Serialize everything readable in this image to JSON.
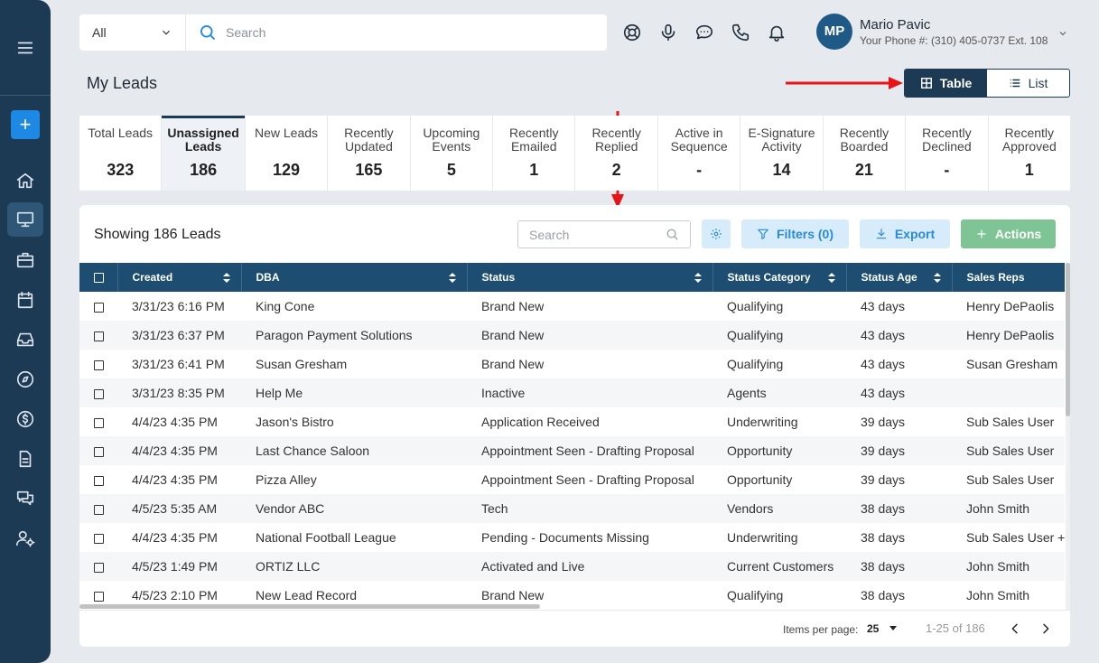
{
  "search": {
    "category": "All",
    "placeholder": "Search"
  },
  "header_icons": [
    "lifebuoy-icon",
    "microphone-icon",
    "chat-icon",
    "phone-icon",
    "bell-icon"
  ],
  "user": {
    "initials": "MP",
    "name": "Mario Pavic",
    "phone": "Your Phone #: (310) 405-0737 Ext. 108"
  },
  "page_title": "My Leads",
  "view_toggle": {
    "table_label": "Table",
    "list_label": "List",
    "selected": "Table"
  },
  "stats": [
    {
      "label": "Total Leads",
      "value": "323",
      "active": false
    },
    {
      "label": "Unassigned Leads",
      "value": "186",
      "active": true
    },
    {
      "label": "New Leads",
      "value": "129",
      "active": false
    },
    {
      "label": "Recently Updated",
      "value": "165",
      "active": false
    },
    {
      "label": "Upcoming Events",
      "value": "5",
      "active": false
    },
    {
      "label": "Recently Emailed",
      "value": "1",
      "active": false
    },
    {
      "label": "Recently Replied",
      "value": "2",
      "active": false
    },
    {
      "label": "Active in Sequence",
      "value": "-",
      "active": false
    },
    {
      "label": "E-Signature Activity",
      "value": "14",
      "active": false
    },
    {
      "label": "Recently Boarded",
      "value": "21",
      "active": false
    },
    {
      "label": "Recently Declined",
      "value": "-",
      "active": false
    },
    {
      "label": "Recently Approved",
      "value": "1",
      "active": false
    }
  ],
  "panel": {
    "showing": "Showing 186 Leads",
    "search_placeholder": "Search",
    "filters_label": "Filters (0)",
    "export_label": "Export",
    "actions_label": "Actions"
  },
  "table": {
    "columns": [
      "Created",
      "DBA",
      "Status",
      "Status Category",
      "Status Age",
      "Sales Reps"
    ],
    "rows": [
      [
        "3/31/23 6:16 PM",
        "King Cone",
        "Brand New",
        "Qualifying",
        "43 days",
        "Henry DePaolis"
      ],
      [
        "3/31/23 6:37 PM",
        "Paragon Payment Solutions",
        "Brand New",
        "Qualifying",
        "43 days",
        "Henry DePaolis"
      ],
      [
        "3/31/23 6:41 PM",
        "Susan Gresham",
        "Brand New",
        "Qualifying",
        "43 days",
        "Susan Gresham"
      ],
      [
        "3/31/23 8:35 PM",
        "Help Me",
        "Inactive",
        "Agents",
        "43 days",
        ""
      ],
      [
        "4/4/23 4:35 PM",
        "Jason's Bistro",
        "Application Received",
        "Underwriting",
        "39 days",
        "Sub Sales User"
      ],
      [
        "4/4/23 4:35 PM",
        "Last Chance Saloon",
        "Appointment Seen - Drafting Proposal",
        "Opportunity",
        "39 days",
        "Sub Sales User"
      ],
      [
        "4/4/23 4:35 PM",
        "Pizza Alley",
        "Appointment Seen - Drafting Proposal",
        "Opportunity",
        "39 days",
        "Sub Sales User"
      ],
      [
        "4/5/23 5:35 AM",
        "Vendor ABC",
        "Tech",
        "Vendors",
        "38 days",
        "John Smith"
      ],
      [
        "4/4/23 4:35 PM",
        "National Football League",
        "Pending - Documents Missing",
        "Underwriting",
        "38 days",
        "Sub Sales User +"
      ],
      [
        "4/5/23 1:49 PM",
        "ORTIZ LLC",
        "Activated and Live",
        "Current Customers",
        "38 days",
        "John Smith"
      ],
      [
        "4/5/23 2:10 PM",
        "New Lead Record",
        "Brand New",
        "Qualifying",
        "38 days",
        "John Smith"
      ]
    ]
  },
  "pagination": {
    "items_per_page_label": "Items per page:",
    "items_per_page": "25",
    "range": "1-25 of 186"
  },
  "annotation_color": "#e8141a"
}
